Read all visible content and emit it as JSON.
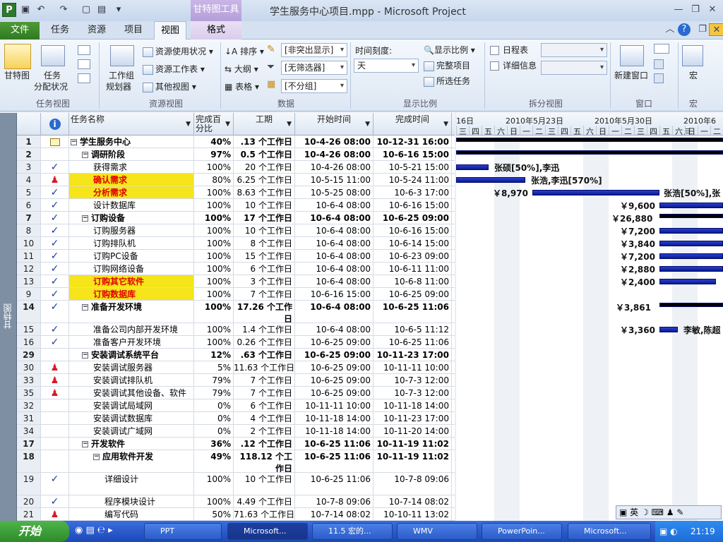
{
  "window": {
    "title": "学生服务中心项目.mpp - Microsoft Project",
    "context_group": "甘特图工具"
  },
  "tabs": {
    "file": "文件",
    "task": "任务",
    "resource": "资源",
    "project": "项目",
    "view": "视图",
    "format": "格式"
  },
  "ribbon": {
    "task_views": {
      "gantt": "甘特图",
      "task_usage": "任务",
      "task_usage2": "分配状况",
      "label": "任务视图"
    },
    "resource_views": {
      "team_planner1": "工作组",
      "team_planner2": "规划器",
      "resource_usage": "资源使用状况",
      "resource_sheet": "资源工作表",
      "other_views": "其他视图",
      "label": "资源视图"
    },
    "data": {
      "sort": "排序",
      "outline": "大纲",
      "tables": "表格",
      "highlight": "[非突出显示]",
      "filter": "[无筛选器]",
      "group": "[不分组]",
      "label": "数据"
    },
    "zoom": {
      "timescale_label": "时间刻度:",
      "timescale_value": "天",
      "zoom": "显示比例",
      "entire_project": "完整项目",
      "selected_tasks": "所选任务",
      "label": "显示比例"
    },
    "split": {
      "timeline": "日程表",
      "details": "详细信息",
      "label": "拆分视图"
    },
    "window": {
      "new_window": "新建窗口",
      "label": "窗口"
    },
    "macros": {
      "macro": "宏",
      "label": "宏"
    }
  },
  "sidebar": {
    "label": "甘特图"
  },
  "columns": {
    "name": "任务名称",
    "pct1": "完成百",
    "pct2": "分比",
    "dur": "工期",
    "start": "开始时间",
    "finish": "完成时间"
  },
  "rows": [
    {
      "id": "1",
      "ind": "note",
      "name": "学生服务中心",
      "pct": "40%",
      "dur": ".13 个工作日",
      "start": "10-4-26 08:00",
      "fin": "10-12-31 16:00",
      "lvl": 0,
      "sum": true,
      "tog": "−"
    },
    {
      "id": "2",
      "ind": "",
      "name": "调研阶段",
      "pct": "97%",
      "dur": "0.5 个工作日",
      "start": "10-4-26 08:00",
      "fin": "10-6-16 15:00",
      "lvl": 1,
      "sum": true,
      "tog": "−"
    },
    {
      "id": "3",
      "ind": "check",
      "name": "获得需求",
      "pct": "100%",
      "dur": "20 个工作日",
      "start": "10-4-26 08:00",
      "fin": "10-5-21 15:00",
      "lvl": 2
    },
    {
      "id": "4",
      "ind": "person",
      "name": "确认需求",
      "pct": "80%",
      "dur": "6.25 个工作日",
      "start": "10-5-15 11:00",
      "fin": "10-5-24 11:00",
      "lvl": 2,
      "hl": true
    },
    {
      "id": "5",
      "ind": "check",
      "name": "分析需求",
      "pct": "100%",
      "dur": "8.63 个工作日",
      "start": "10-5-25 08:00",
      "fin": "10-6-3 17:00",
      "lvl": 2,
      "hl": true
    },
    {
      "id": "6",
      "ind": "check",
      "name": "设计数据库",
      "pct": "100%",
      "dur": "10 个工作日",
      "start": "10-6-4 08:00",
      "fin": "10-6-16 15:00",
      "lvl": 2
    },
    {
      "id": "7",
      "ind": "check",
      "name": "订购设备",
      "pct": "100%",
      "dur": "17 个工作日",
      "start": "10-6-4 08:00",
      "fin": "10-6-25 09:00",
      "lvl": 1,
      "sum": true,
      "tog": "−"
    },
    {
      "id": "8",
      "ind": "check",
      "name": "订购服务器",
      "pct": "100%",
      "dur": "10 个工作日",
      "start": "10-6-4 08:00",
      "fin": "10-6-16 15:00",
      "lvl": 2
    },
    {
      "id": "10",
      "ind": "check",
      "name": "订购排队机",
      "pct": "100%",
      "dur": "8 个工作日",
      "start": "10-6-4 08:00",
      "fin": "10-6-14 15:00",
      "lvl": 2
    },
    {
      "id": "11",
      "ind": "check",
      "name": "订购PC设备",
      "pct": "100%",
      "dur": "15 个工作日",
      "start": "10-6-4 08:00",
      "fin": "10-6-23 09:00",
      "lvl": 2
    },
    {
      "id": "12",
      "ind": "check",
      "name": "订购网络设备",
      "pct": "100%",
      "dur": "6 个工作日",
      "start": "10-6-4 08:00",
      "fin": "10-6-11 11:00",
      "lvl": 2
    },
    {
      "id": "13",
      "ind": "check",
      "name": "订购其它软件",
      "pct": "100%",
      "dur": "3 个工作日",
      "start": "10-6-4 08:00",
      "fin": "10-6-8 11:00",
      "lvl": 2,
      "hl": true
    },
    {
      "id": "9",
      "ind": "check",
      "name": "订购数据库",
      "pct": "100%",
      "dur": "7 个工作日",
      "start": "10-6-16 15:00",
      "fin": "10-6-25 09:00",
      "lvl": 2,
      "hl": true
    },
    {
      "id": "14",
      "ind": "check",
      "name": "准备开发环境",
      "pct": "100%",
      "dur": "17.26 个工作",
      "dur2": "日",
      "start": "10-6-4 08:00",
      "fin": "10-6-25 11:06",
      "lvl": 1,
      "sum": true,
      "tog": "−",
      "tall": true
    },
    {
      "id": "15",
      "ind": "check",
      "name": "准备公司内部开发环境",
      "pct": "100%",
      "dur": "1.4 个工作日",
      "start": "10-6-4 08:00",
      "fin": "10-6-5 11:12",
      "lvl": 2
    },
    {
      "id": "16",
      "ind": "check",
      "name": "准备客户开发环境",
      "pct": "100%",
      "dur": "0.26 个工作日",
      "start": "10-6-25 09:00",
      "fin": "10-6-25 11:06",
      "lvl": 2
    },
    {
      "id": "29",
      "ind": "",
      "name": "安装调试系统平台",
      "pct": "12%",
      "dur": ".63 个工作日",
      "start": "10-6-25 09:00",
      "fin": "10-11-23 17:00",
      "lvl": 1,
      "sum": true,
      "tog": "−"
    },
    {
      "id": "30",
      "ind": "person",
      "name": "安装调试服务器",
      "pct": "5%",
      "dur": "11.63 个工作日",
      "start": "10-6-25 09:00",
      "fin": "10-11-11 10:00",
      "lvl": 2
    },
    {
      "id": "33",
      "ind": "person",
      "name": "安装调试排队机",
      "pct": "79%",
      "dur": "7 个工作日",
      "start": "10-6-25 09:00",
      "fin": "10-7-3 12:00",
      "lvl": 2
    },
    {
      "id": "35",
      "ind": "person",
      "name": "安装调试其他设备、软件",
      "pct": "79%",
      "dur": "7 个工作日",
      "start": "10-6-25 09:00",
      "fin": "10-7-3 12:00",
      "lvl": 2
    },
    {
      "id": "32",
      "ind": "",
      "name": "安装调试局域网",
      "pct": "0%",
      "dur": "6 个工作日",
      "start": "10-11-11 10:00",
      "fin": "10-11-18 14:00",
      "lvl": 2
    },
    {
      "id": "31",
      "ind": "",
      "name": "安装调试数据库",
      "pct": "0%",
      "dur": "4 个工作日",
      "start": "10-11-18 14:00",
      "fin": "10-11-23 17:00",
      "lvl": 2
    },
    {
      "id": "34",
      "ind": "",
      "name": "安装调试广域网",
      "pct": "0%",
      "dur": "2 个工作日",
      "start": "10-11-18 14:00",
      "fin": "10-11-20 14:00",
      "lvl": 2
    },
    {
      "id": "17",
      "ind": "",
      "name": "开发软件",
      "pct": "36%",
      "dur": ".12 个工作日",
      "start": "10-6-25 11:06",
      "fin": "10-11-19 11:02",
      "lvl": 1,
      "sum": true,
      "tog": "−"
    },
    {
      "id": "18",
      "ind": "",
      "name": "应用软件开发",
      "pct": "49%",
      "dur": "118.12 个工",
      "dur2": "作日",
      "start": "10-6-25 11:06",
      "fin": "10-11-19 11:02",
      "lvl": 2,
      "sum": true,
      "tog": "−",
      "tall": true
    },
    {
      "id": "19",
      "ind": "check",
      "name": "详细设计",
      "pct": "100%",
      "dur": "10 个工作日",
      "start": "10-6-25 11:06",
      "fin": "10-7-8 09:06",
      "lvl": 3,
      "tall": true
    },
    {
      "id": "20",
      "ind": "check",
      "name": "程序模块设计",
      "pct": "100%",
      "dur": "4.49 个工作日",
      "start": "10-7-8 09:06",
      "fin": "10-7-14 08:02",
      "lvl": 3
    },
    {
      "id": "21",
      "ind": "person",
      "name": "编写代码",
      "pct": "50%",
      "dur": "71.63 个工作日",
      "start": "10-7-14 08:02",
      "fin": "10-10-11 13:02",
      "lvl": 3
    }
  ],
  "gantt": {
    "weeks": [
      "16日",
      "2010年5月23日",
      "2010年5月30日",
      "2010年6月"
    ],
    "days": [
      "三",
      "四",
      "五",
      "六",
      "日",
      "一",
      "二",
      "三",
      "四",
      "五",
      "六",
      "日",
      "一",
      "二",
      "三",
      "四",
      "五",
      "六",
      "日",
      "一",
      "二"
    ],
    "labels": {
      "r3": "张硕[50%],李迅",
      "r4": "张浩,李迅[570%]",
      "r5a": "￥8,970",
      "r5b": "张浩[50%],张",
      "r6": "￥9,600",
      "r7": "￥26,880",
      "r8": "￥7,200",
      "r10": "￥3,840",
      "r11": "￥7,200",
      "r12": "￥2,880",
      "r13": "￥2,400",
      "r14": "￥3,861",
      "r15a": "￥3,360",
      "r15b": "李敏,陈超"
    }
  },
  "ime": {
    "label": "英"
  },
  "taskbar": {
    "start": "开始",
    "items": [
      "PPT",
      "Microsoft...",
      "11.5 宏的...",
      "WMV",
      "PowerPoin...",
      "Microsoft..."
    ],
    "clock": "21:19"
  }
}
